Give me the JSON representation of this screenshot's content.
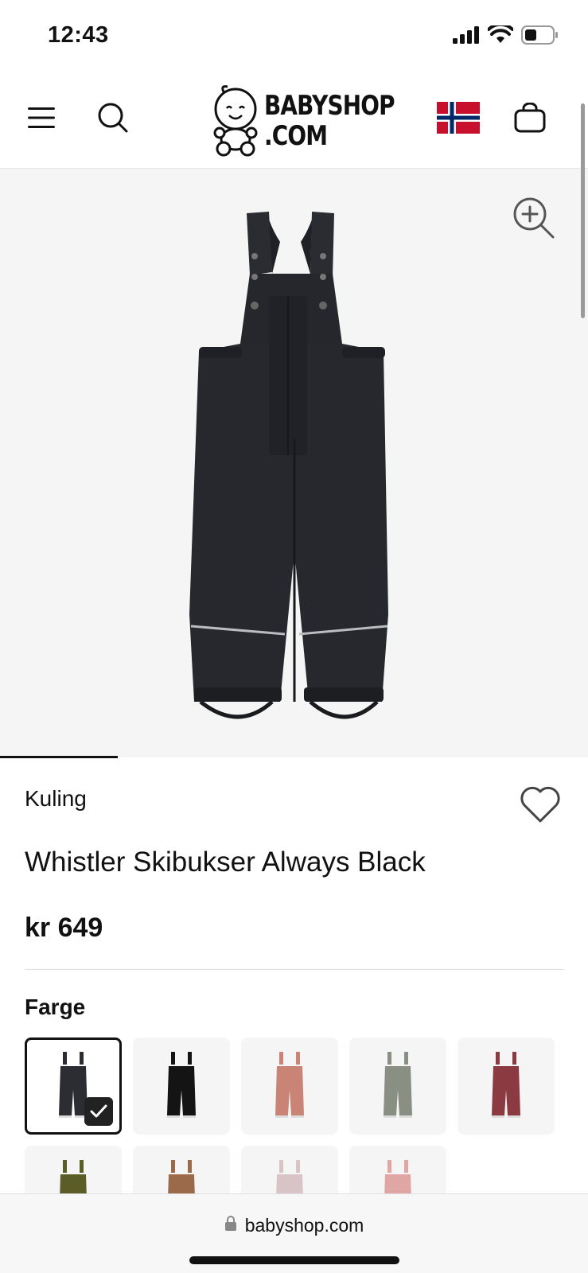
{
  "status_bar": {
    "time": "12:43",
    "icons": [
      "signal-icon",
      "wifi-icon",
      "battery-icon"
    ]
  },
  "header": {
    "menu_icon": "menu-icon",
    "search_icon": "search-icon",
    "logo_line1": "BABYSHOP",
    "logo_line2": ".COM",
    "flag_icon": "norway-flag-icon",
    "cart_icon": "shopping-bag-icon"
  },
  "gallery": {
    "zoom_icon": "zoom-in-icon",
    "product_image": "black ski bib pants"
  },
  "product": {
    "brand": "Kuling",
    "title": "Whistler Skibukser Always Black",
    "price": "kr 649",
    "wishlist_icon": "heart-icon"
  },
  "color_section": {
    "label": "Farge",
    "swatches": [
      {
        "color": "#2b2d33",
        "selected": true
      },
      {
        "color": "#141414",
        "selected": false
      },
      {
        "color": "#c98476",
        "selected": false
      },
      {
        "color": "#8a8f84",
        "selected": false
      },
      {
        "color": "#8b3a42",
        "selected": false
      },
      {
        "color": "#5a5e26",
        "selected": false
      },
      {
        "color": "#9a6a4a",
        "selected": false
      },
      {
        "color": "#d8c4c6",
        "selected": false
      },
      {
        "color": "#e0a6a4",
        "selected": false
      }
    ]
  },
  "browser": {
    "url": "babyshop.com",
    "lock_icon": "lock-icon"
  },
  "colors": {
    "flag_red": "#c8102e",
    "flag_blue": "#002868",
    "image_bg": "#f5f5f5"
  }
}
